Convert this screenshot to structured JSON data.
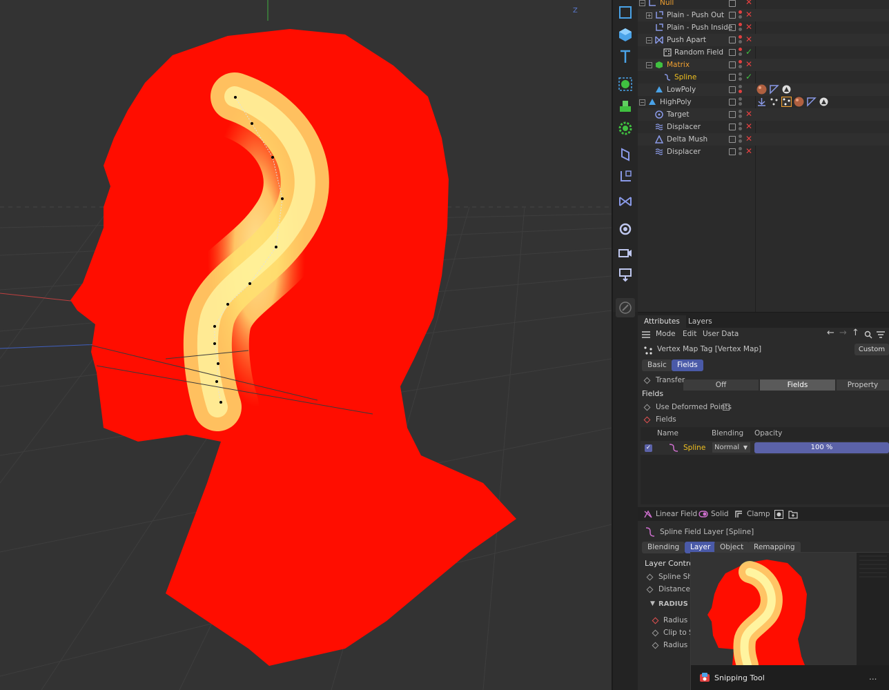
{
  "viewport": {
    "axis_label": "Z"
  },
  "palette": {
    "tools": [
      "cube-outline-icon",
      "cube-icon",
      "text-icon",
      "spline-gen-icon",
      "cloner-icon",
      "gear-icon",
      "deformer-icon",
      "null-axis-icon",
      "mograph-effector-icon",
      "scene-icon",
      "camera-icon",
      "floor-icon",
      "sculpt-icon"
    ]
  },
  "objects": [
    {
      "name": "Null",
      "level": 0,
      "state": "x",
      "highlight": "orange"
    },
    {
      "name": "Plain - Push Out",
      "level": 1,
      "state": "x"
    },
    {
      "name": "Plain - Push Inside",
      "level": 1,
      "state": "x"
    },
    {
      "name": "Push Apart",
      "level": 1,
      "state": "x"
    },
    {
      "name": "Random Field",
      "level": 2,
      "state": "ok"
    },
    {
      "name": "Matrix",
      "level": 1,
      "state": "x",
      "highlight": "orange"
    },
    {
      "name": "Spline",
      "level": 2,
      "state": "ok",
      "highlight": "yellow"
    },
    {
      "name": "LowPoly",
      "level": 1,
      "state": ""
    },
    {
      "name": "HighPoly",
      "level": 0,
      "state": ""
    },
    {
      "name": "Target",
      "level": 1,
      "state": "x"
    },
    {
      "name": "Displacer",
      "level": 1,
      "state": "x"
    },
    {
      "name": "Delta Mush",
      "level": 1,
      "state": "x"
    },
    {
      "name": "Displacer",
      "level": 1,
      "state": "x"
    }
  ],
  "attributes": {
    "tab_attributes": "Attributes",
    "tab_layers": "Layers",
    "menu_mode": "Mode",
    "menu_edit": "Edit",
    "menu_userdata": "User Data",
    "title": "Vertex Map Tag [Vertex Map]",
    "custom_button": "Custom",
    "tab_basic": "Basic",
    "tab_fields": "Fields",
    "transfer_label": "Transfer",
    "transfer_off": "Off",
    "transfer_fields": "Fields",
    "transfer_property": "Property",
    "fields_heading": "Fields",
    "use_deformed_points": "Use Deformed Points",
    "fields_label": "Fields",
    "col_name": "Name",
    "col_blending": "Blending",
    "col_opacity": "Opacity",
    "field_row": {
      "name": "Spline",
      "blending": "Normal",
      "opacity": "100 %"
    },
    "tool_linear_field": "Linear Field",
    "tool_solid": "Solid",
    "tool_clamp": "Clamp",
    "layer_title": "Spline Field Layer [Spline]",
    "tab_blending": "Blending",
    "tab_layer": "Layer",
    "tab_object": "Object",
    "tab_remapping": "Remapping",
    "layer_controls": "Layer Controls",
    "spline_shape": "Spline Sha",
    "distance_mode": "Distance M",
    "radius_group": "RADIUS OF",
    "radius": "Radius",
    "clip_to": "Clip to Sl",
    "radius_falloff": "Radius Fa"
  },
  "snipping_tool": {
    "title": "Snipping Tool",
    "more": "..."
  }
}
